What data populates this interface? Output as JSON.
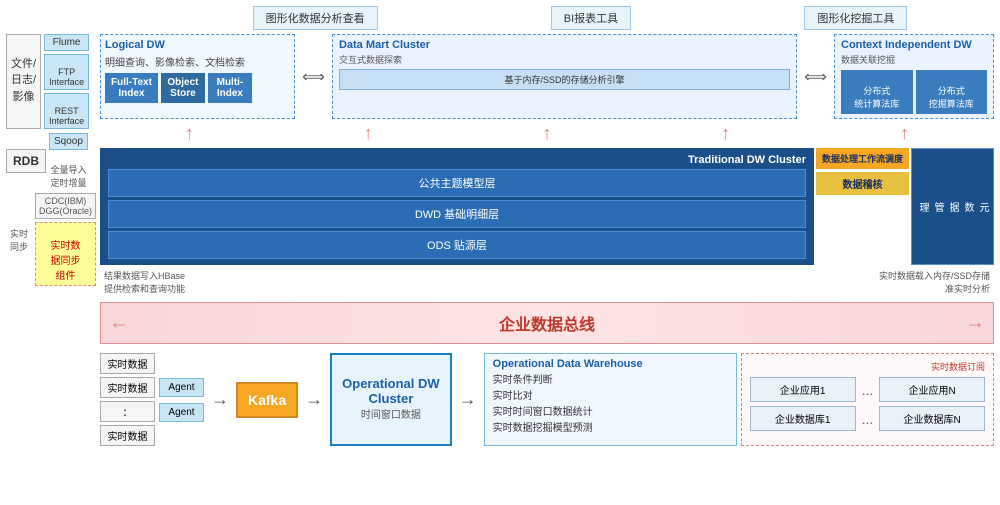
{
  "top_labels": {
    "label1": "图形化数据分析查看",
    "label2": "BI报表工具",
    "label3": "图形化挖掘工具"
  },
  "left_sidebar": {
    "file_box": "文件/\n日志/\n影像",
    "rdb_box": "RDB",
    "sync_label": "实时同步",
    "connectors": {
      "flume": "Flume",
      "ftp": "FTP\nInterface",
      "rest": "REST\nInterface"
    },
    "sqoop": "Sqoop",
    "sqoop_note": "全量导入\n定时增量",
    "cdc": "CDC(IBM)\nDGG(Oracle)",
    "realtime_sync": "实时数\n据同步\n组件"
  },
  "logical_dw": {
    "title": "Logical DW",
    "subtitle": "明细查询、影像检索、文档检索",
    "full_text_index": "Full-Text\nIndex",
    "object_store": "Object\nStore",
    "multi_index": "Multi-\nIndex"
  },
  "data_mart": {
    "title": "Data Mart Cluster",
    "subtitle": "交互式数据探索",
    "storage_note": "基于内存/SSD的存储分析引擎"
  },
  "context_dw": {
    "title": "Context Independent DW",
    "subtitle": "数据关联挖掘",
    "dist_stat": "分布式\n统计算法库",
    "dist_mine": "分布式\n挖掘算法库"
  },
  "traditional_dw": {
    "title": "Traditional DW Cluster",
    "layer1": "公共主题模型层",
    "layer2": "DWD 基础明细层",
    "layer3": "ODS 贴源层",
    "process_sched": "数据处理工作流调度",
    "data_nucleus": "数据稽核",
    "meta_mgmt": "元\n数\n据\n管\n理"
  },
  "enterprise_bus": {
    "label": "企业数据总线"
  },
  "annotations": {
    "left_note1": "结果数据写入HBase",
    "left_note2": "提供检索和查询功能",
    "right_note1": "实时数据载入内存/SSD存储",
    "right_note2": "准实时分析"
  },
  "bottom": {
    "rt_data1": "实时数据",
    "rt_data2": "实时数据",
    "rt_data3": "：",
    "rt_data4": "实时数据",
    "agent1": "Agent",
    "agent2": "Agent",
    "kafka": "Kafka",
    "op_dw_title": "Operational DW\nCluster",
    "op_dw_sub": "时间窗口数据",
    "op_warehouse_title": "Operational Data Warehouse",
    "op_items": [
      "实时条件判断",
      "实时比对",
      "实时时间窗口数据统计",
      "实时数据挖掘模型预测"
    ],
    "rt_subscribe_label": "实时数据订阅",
    "enterprise_apps": {
      "app1": "企业应用1",
      "appN": "企业应用N",
      "db1": "企业数据库1",
      "dbN": "企业数据库N"
    }
  }
}
